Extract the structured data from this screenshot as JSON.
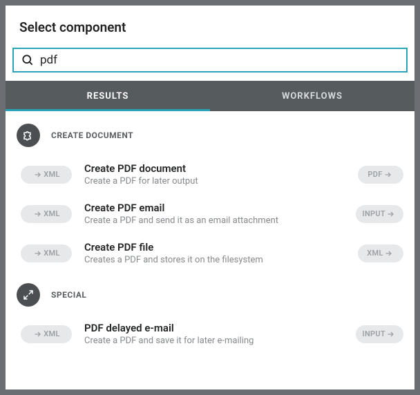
{
  "dialog": {
    "title": "Select component"
  },
  "search": {
    "value": "pdf",
    "placeholder": ""
  },
  "tabs": {
    "results": "RESULTS",
    "workflows": "WORKFLOWS",
    "active": "results"
  },
  "groups": [
    {
      "id": "create-document",
      "title": "CREATE DOCUMENT",
      "icon": "puzzle",
      "items": [
        {
          "in": "XML",
          "title": "Create PDF document",
          "desc": "Create a PDF for later output",
          "out": "PDF"
        },
        {
          "in": "XML",
          "title": "Create PDF email",
          "desc": "Create a PDF and send it as an email attachment",
          "out": "INPUT"
        },
        {
          "in": "XML",
          "title": "Create PDF file",
          "desc": "Creates a PDF and stores it on the filesystem",
          "out": "XML"
        }
      ]
    },
    {
      "id": "special",
      "title": "SPECIAL",
      "icon": "arrows",
      "items": [
        {
          "in": "XML",
          "title": "PDF delayed e-mail",
          "desc": "Create a PDF and save it for later e-mailing",
          "out": "INPUT"
        }
      ]
    }
  ]
}
